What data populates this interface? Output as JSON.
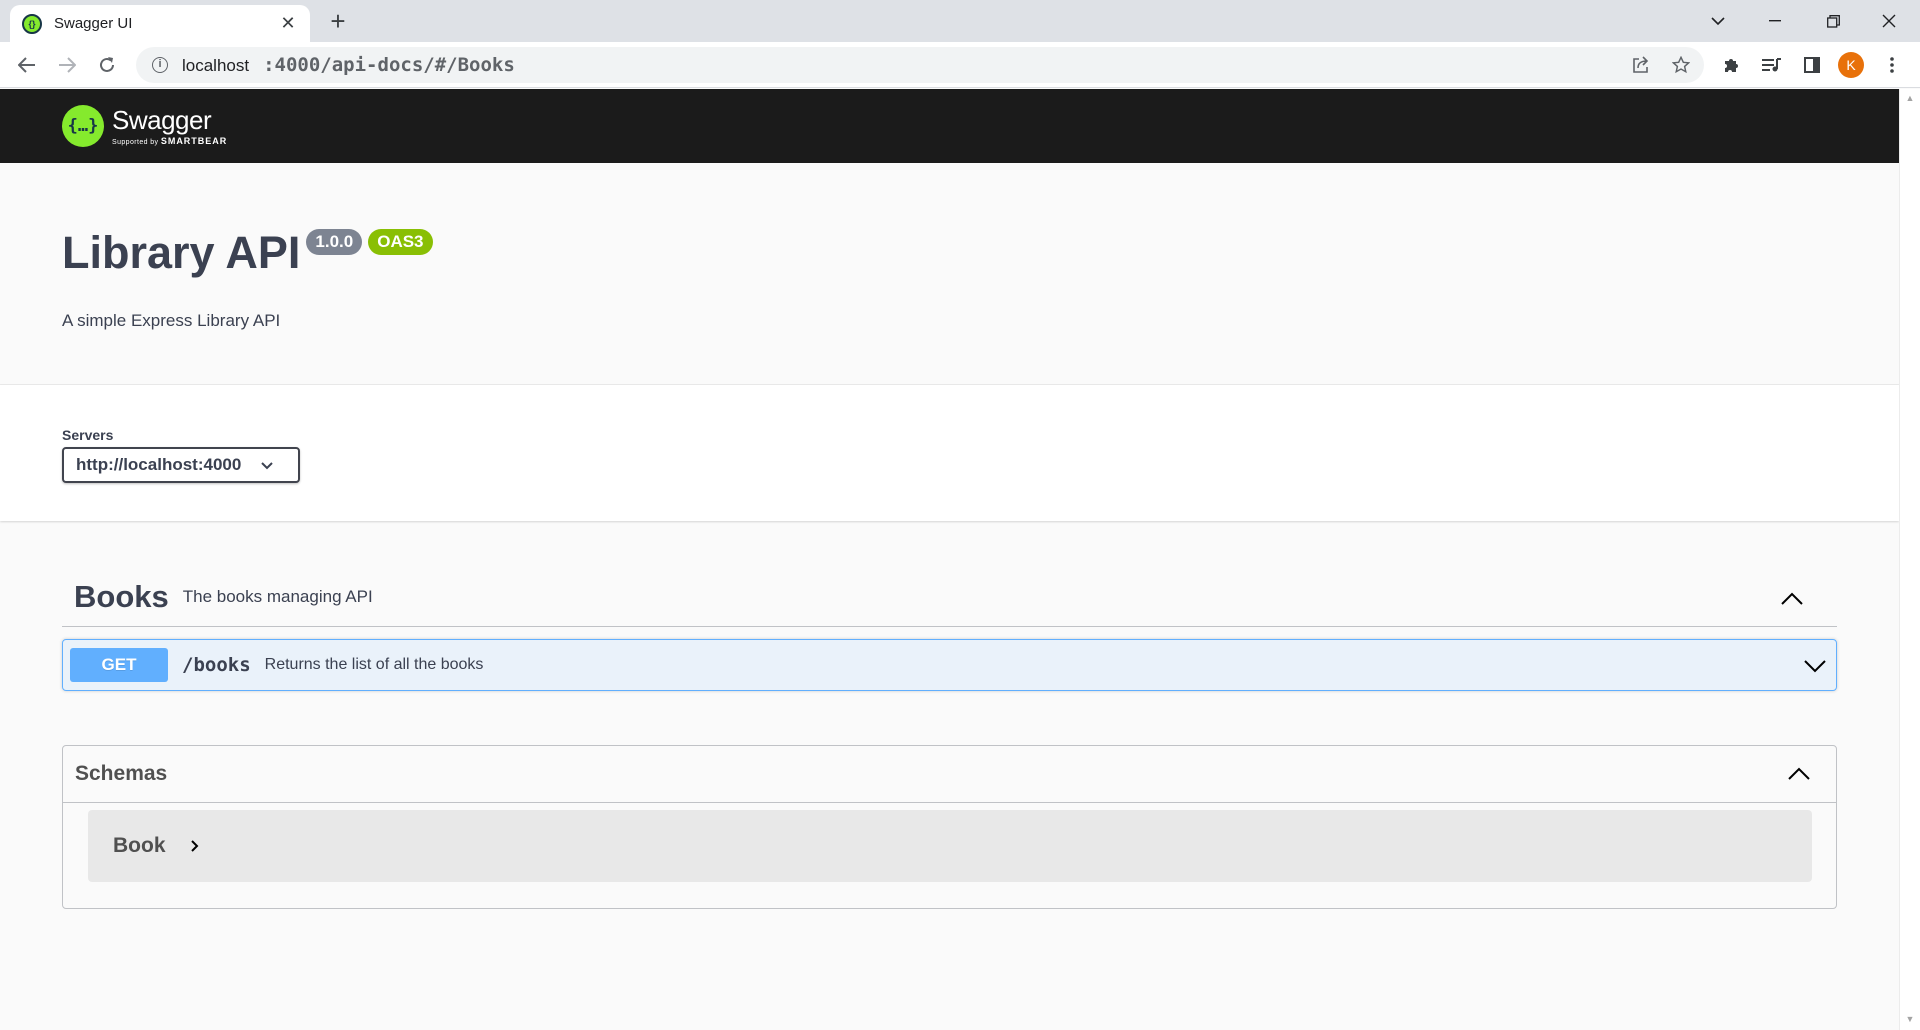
{
  "browser": {
    "tab_title": "Swagger UI",
    "tab_close": "✕",
    "new_tab": "+",
    "url_host": "localhost",
    "url_path": ":4000/api-docs/#/Books",
    "profile_initial": "K"
  },
  "swagger": {
    "logo_word": "Swagger",
    "logo_supported": "Supported by",
    "logo_brand": "SMARTBEAR"
  },
  "info": {
    "title": "Library API",
    "version": "1.0.0",
    "oas": "OAS3",
    "description": "A simple Express Library API"
  },
  "servers": {
    "label": "Servers",
    "selected": "http://localhost:4000"
  },
  "tag": {
    "name": "Books",
    "description": "The books managing API"
  },
  "operation": {
    "method": "GET",
    "path": "/books",
    "summary": "Returns the list of all the books"
  },
  "models": {
    "title": "Schemas",
    "items": [
      {
        "name": "Book"
      }
    ]
  },
  "colors": {
    "get_method": "#61affe",
    "oas_badge": "#89bf04",
    "version_badge": "#7d8492",
    "topbar": "#1b1b1b",
    "logo": "#85ea2d"
  }
}
